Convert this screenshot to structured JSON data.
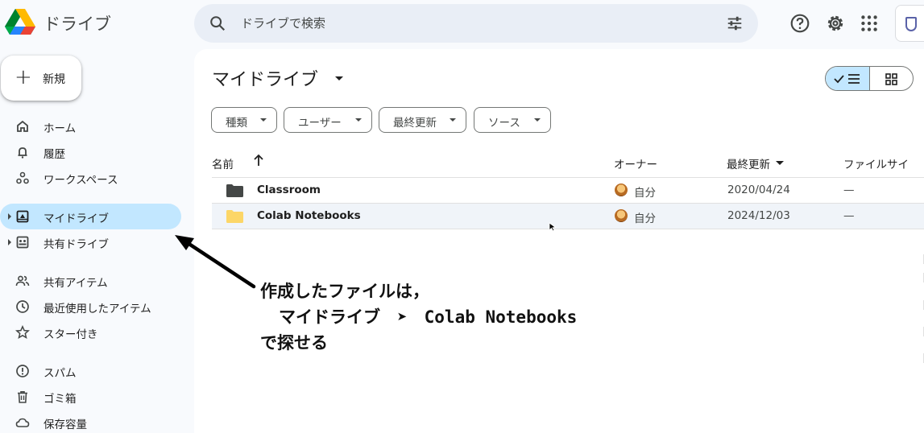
{
  "header": {
    "app_name": "ドライブ",
    "search_placeholder": "ドライブで検索"
  },
  "sidebar": {
    "new_label": "新規",
    "items": [
      {
        "label": "ホーム",
        "icon": "home-icon"
      },
      {
        "label": "履歴",
        "icon": "bell-icon"
      },
      {
        "label": "ワークスペース",
        "icon": "workspaces-icon"
      },
      {
        "label": "マイドライブ",
        "icon": "my-drive-icon",
        "active": true
      },
      {
        "label": "共有ドライブ",
        "icon": "shared-drives-icon"
      },
      {
        "label": "共有アイテム",
        "icon": "people-icon"
      },
      {
        "label": "最近使用したアイテム",
        "icon": "clock-icon"
      },
      {
        "label": "スター付き",
        "icon": "star-icon"
      },
      {
        "label": "スパム",
        "icon": "spam-icon"
      },
      {
        "label": "ゴミ箱",
        "icon": "trash-icon"
      },
      {
        "label": "保存容量",
        "icon": "cloud-icon"
      }
    ]
  },
  "main": {
    "title": "マイドライブ",
    "filters": [
      "種類",
      "ユーザー",
      "最終更新",
      "ソース"
    ],
    "columns": {
      "name": "名前",
      "owner": "オーナー",
      "modified": "最終更新",
      "size": "ファイルサイ"
    },
    "rows": [
      {
        "name": "Classroom",
        "owner": "自分",
        "date": "2020/04/24",
        "size": "—"
      },
      {
        "name": "Colab Notebooks",
        "owner": "自分",
        "date": "2024/12/03",
        "size": "—"
      }
    ]
  },
  "annotation": {
    "line1": "作成したファイルは，",
    "line2": "マイドライブ　➤　Colab Notebooks",
    "line3": "で探せる"
  },
  "colors": {
    "accent": "#c2e7ff",
    "folder_dark": "#444746",
    "folder_yellow": "#fcd667"
  }
}
